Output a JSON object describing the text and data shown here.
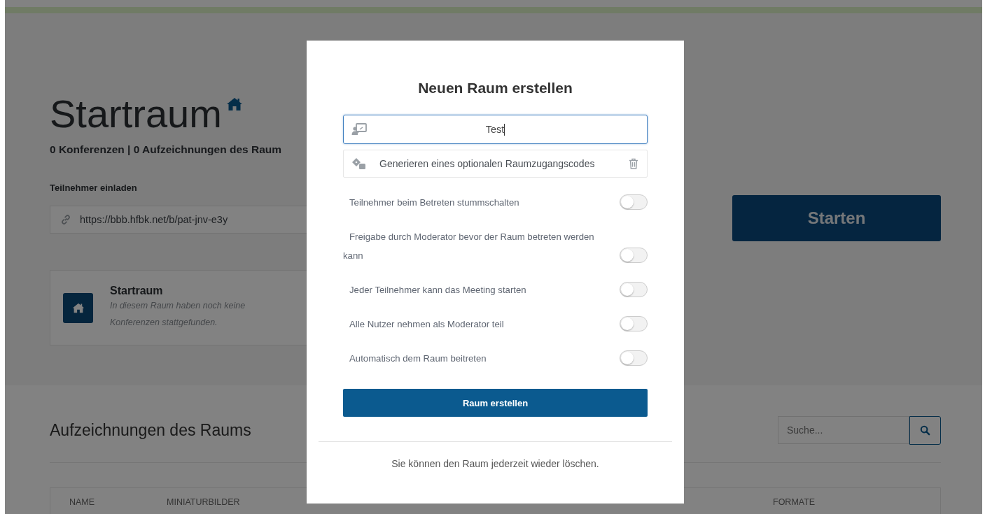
{
  "room": {
    "title": "Startraum",
    "stats": "0 Konferenzen | 0 Aufzeichnungen des Raum",
    "invite_label": "Teilnehmer einladen",
    "invite_url": "https://bbb.hfbk.net/b/pat-jnv-e3y",
    "start_button": "Starten"
  },
  "room_card": {
    "name": "Startraum",
    "description": "In diesem Raum haben noch keine Konferenzen stattgefunden."
  },
  "recordings": {
    "heading": "Aufzeichnungen des Raums",
    "search_placeholder": "Suche...",
    "columns": [
      "NAME",
      "MINIATURBILDER",
      "FORMATE"
    ]
  },
  "modal": {
    "title": "Neuen Raum erstellen",
    "name_value": "Test",
    "access_code_label": "Generieren eines optionalen Raumzugangscodes",
    "options": [
      {
        "label": "Teilnehmer beim Betreten stummschalten",
        "on": false
      },
      {
        "label": "Freigabe durch Moderator bevor der Raum betreten werden kann",
        "on": false
      },
      {
        "label": "Jeder Teilnehmer kann das Meeting starten",
        "on": false
      },
      {
        "label": "Alle Nutzer nehmen als Moderator teil",
        "on": false
      },
      {
        "label": "Automatisch dem Raum beitreten",
        "on": false
      }
    ],
    "submit": "Raum erstellen",
    "footer": "Sie können den Raum jederzeit wieder löschen."
  }
}
